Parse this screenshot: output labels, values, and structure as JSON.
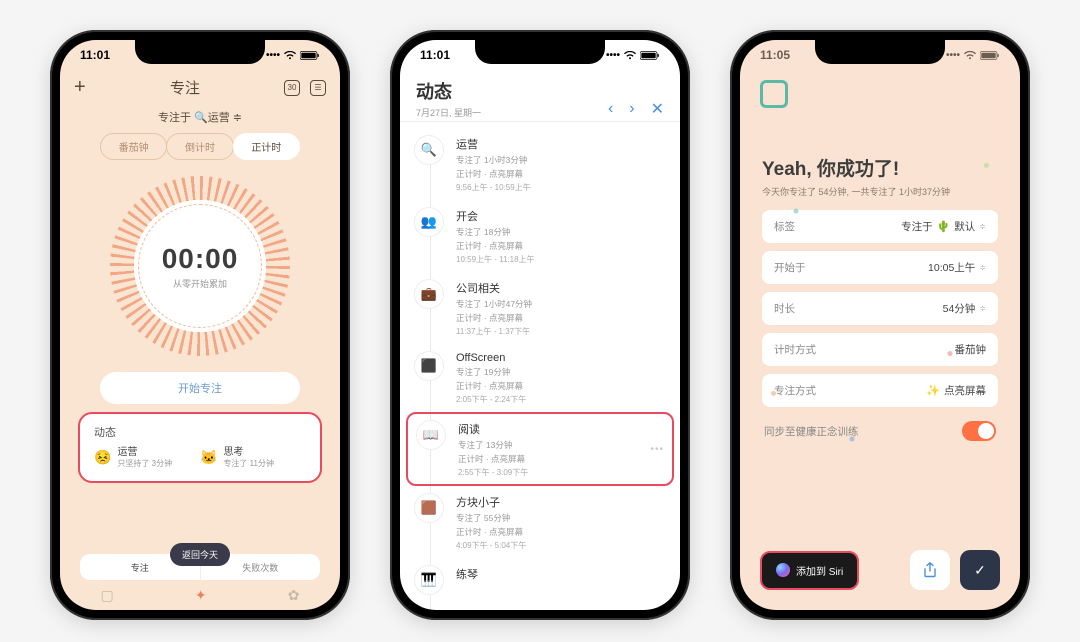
{
  "phone1": {
    "status_time": "11:01",
    "header_title": "专注",
    "focus_on_prefix": "专注于",
    "focus_tag": "运营",
    "tabs": [
      "番茄钟",
      "倒计时",
      "正计时"
    ],
    "active_tab_index": 2,
    "timer_value": "00:00",
    "timer_sub": "从零开始累加",
    "start_button": "开始专注",
    "dynamic_title": "动态",
    "dynamic_items": [
      {
        "emoji": "😣",
        "name": "运营",
        "sub": "只坚持了 3分钟"
      },
      {
        "emoji": "🐱",
        "name": "思考",
        "sub": "专注了 11分钟"
      }
    ],
    "return_today": "返回今天",
    "bottom_segments": [
      "专注",
      "失败次数"
    ]
  },
  "phone2": {
    "status_time": "11:01",
    "title": "动态",
    "subtitle": "7月27日, 星期一",
    "items": [
      {
        "icon": "🔍",
        "name": "运营",
        "line1": "专注了 1小时3分钟",
        "line2": "正计时 · 点亮屏幕",
        "time": "9:56上午 - 10:59上午"
      },
      {
        "icon": "👥",
        "name": "开会",
        "line1": "专注了 18分钟",
        "line2": "正计时 · 点亮屏幕",
        "time": "10:59上午 - 11:18上午"
      },
      {
        "icon": "💼",
        "name": "公司相关",
        "line1": "专注了 1小时47分钟",
        "line2": "正计时 · 点亮屏幕",
        "time": "11:37上午 - 1:37下午"
      },
      {
        "icon": "⬛",
        "name": "OffScreen",
        "line1": "专注了 19分钟",
        "line2": "正计时 · 点亮屏幕",
        "time": "2:05下午 - 2:24下午"
      },
      {
        "icon": "📖",
        "name": "阅读",
        "line1": "专注了 13分钟",
        "line2": "正计时 · 点亮屏幕",
        "time": "2:55下午 - 3:09下午",
        "highlight": true
      },
      {
        "icon": "🟫",
        "name": "方块小子",
        "line1": "专注了 55分钟",
        "line2": "正计时 · 点亮屏幕",
        "time": "4:09下午 - 5:04下午"
      },
      {
        "icon": "🎹",
        "name": "练琴",
        "line1": "",
        "line2": "",
        "time": ""
      }
    ]
  },
  "phone3": {
    "status_time": "11:05",
    "title": "Yeah, 你成功了!",
    "subtitle": "今天你专注了 54分钟, 一共专注了 1小时37分钟",
    "rows": {
      "tag_label": "标签",
      "tag_value": "专注于",
      "tag_value_suffix": "默认",
      "start_label": "开始于",
      "start_value": "10:05上午",
      "duration_label": "时长",
      "duration_value": "54分钟",
      "mode_label": "计时方式",
      "mode_value": "番茄钟",
      "focus_label": "专注方式",
      "focus_value": "点亮屏幕"
    },
    "sync_label": "同步至健康正念训练",
    "siri_label": "添加到 Siri"
  }
}
